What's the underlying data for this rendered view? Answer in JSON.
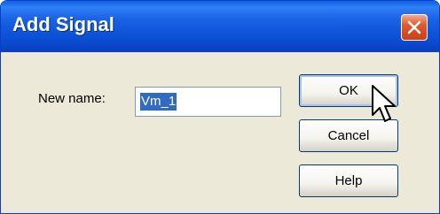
{
  "window": {
    "title": "Add Signal"
  },
  "title_bar": {
    "close_icon": "close-icon"
  },
  "form": {
    "new_name_label": "New name:",
    "new_name_value": "Vm_1"
  },
  "buttons": {
    "ok_label": "OK",
    "cancel_label": "Cancel",
    "help_label": "Help"
  },
  "cursor": {
    "icon": "mouse-pointer-icon"
  },
  "colors": {
    "title_bar": "#0a50d6",
    "close_button": "#e2582c",
    "dialog_background": "#ece9d8",
    "selection": "#316ac5"
  }
}
